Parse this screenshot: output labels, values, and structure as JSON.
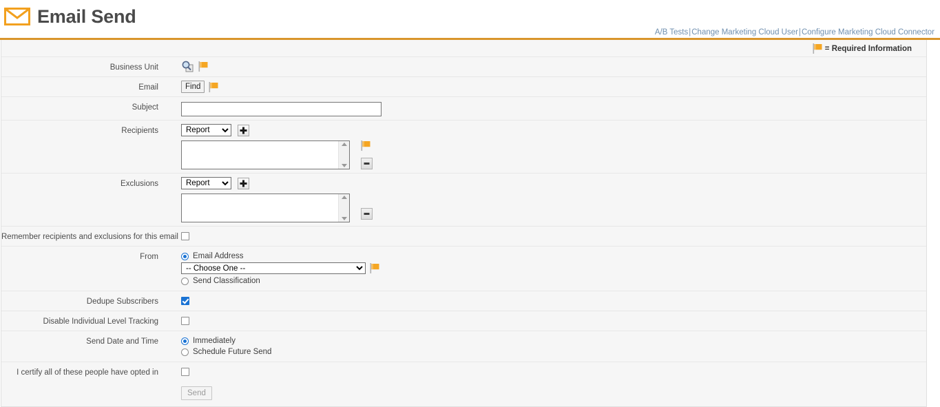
{
  "header": {
    "title": "Email Send",
    "icon": "envelope-icon",
    "links": [
      {
        "label": "A/B Tests"
      },
      {
        "label": "Change Marketing Cloud User"
      },
      {
        "label": "Configure Marketing Cloud Connector"
      }
    ],
    "link_separator": "|"
  },
  "form": {
    "required_note": "= Required Information",
    "required_flag_icon": "flag-icon",
    "rows": {
      "business_unit": {
        "label": "Business Unit",
        "lookup_icon": "search-lookup-icon",
        "required": true
      },
      "email": {
        "label": "Email",
        "find_button": "Find",
        "required": true
      },
      "subject": {
        "label": "Subject",
        "value": "",
        "placeholder": ""
      },
      "recipients": {
        "label": "Recipients",
        "type_selected": "Report",
        "type_options": [
          "Report"
        ],
        "add_button_icon": "plus-icon",
        "remove_button_icon": "minus-icon",
        "list_values": [],
        "required": true
      },
      "exclusions": {
        "label": "Exclusions",
        "type_selected": "Report",
        "type_options": [
          "Report"
        ],
        "add_button_icon": "plus-icon",
        "remove_button_icon": "minus-icon",
        "list_values": [],
        "required": false
      },
      "remember": {
        "label": "Remember recipients and exclusions for this email",
        "checked": false
      },
      "from": {
        "label": "From",
        "option_email_address": "Email Address",
        "option_send_classification": "Send Classification",
        "selected": "Email Address",
        "dropdown_selected": "-- Choose One --",
        "dropdown_options": [
          "-- Choose One --"
        ],
        "required": true
      },
      "dedupe": {
        "label": "Dedupe Subscribers",
        "checked": true
      },
      "disable_tracking": {
        "label": "Disable Individual Level Tracking",
        "checked": false
      },
      "send_date": {
        "label": "Send Date and Time",
        "option_immediately": "Immediately",
        "option_schedule": "Schedule Future Send",
        "selected": "Immediately"
      },
      "certify": {
        "label": "I certify all of these people have opted in",
        "checked": false
      },
      "submit": {
        "label": "Send",
        "disabled": true
      }
    }
  },
  "colors": {
    "accent_orange": "#f2a01e",
    "rule_orange": "#d9952c",
    "link_blue": "#6f8faf",
    "checkbox_blue": "#1a73d4",
    "form_bg": "#f6f6f6"
  }
}
